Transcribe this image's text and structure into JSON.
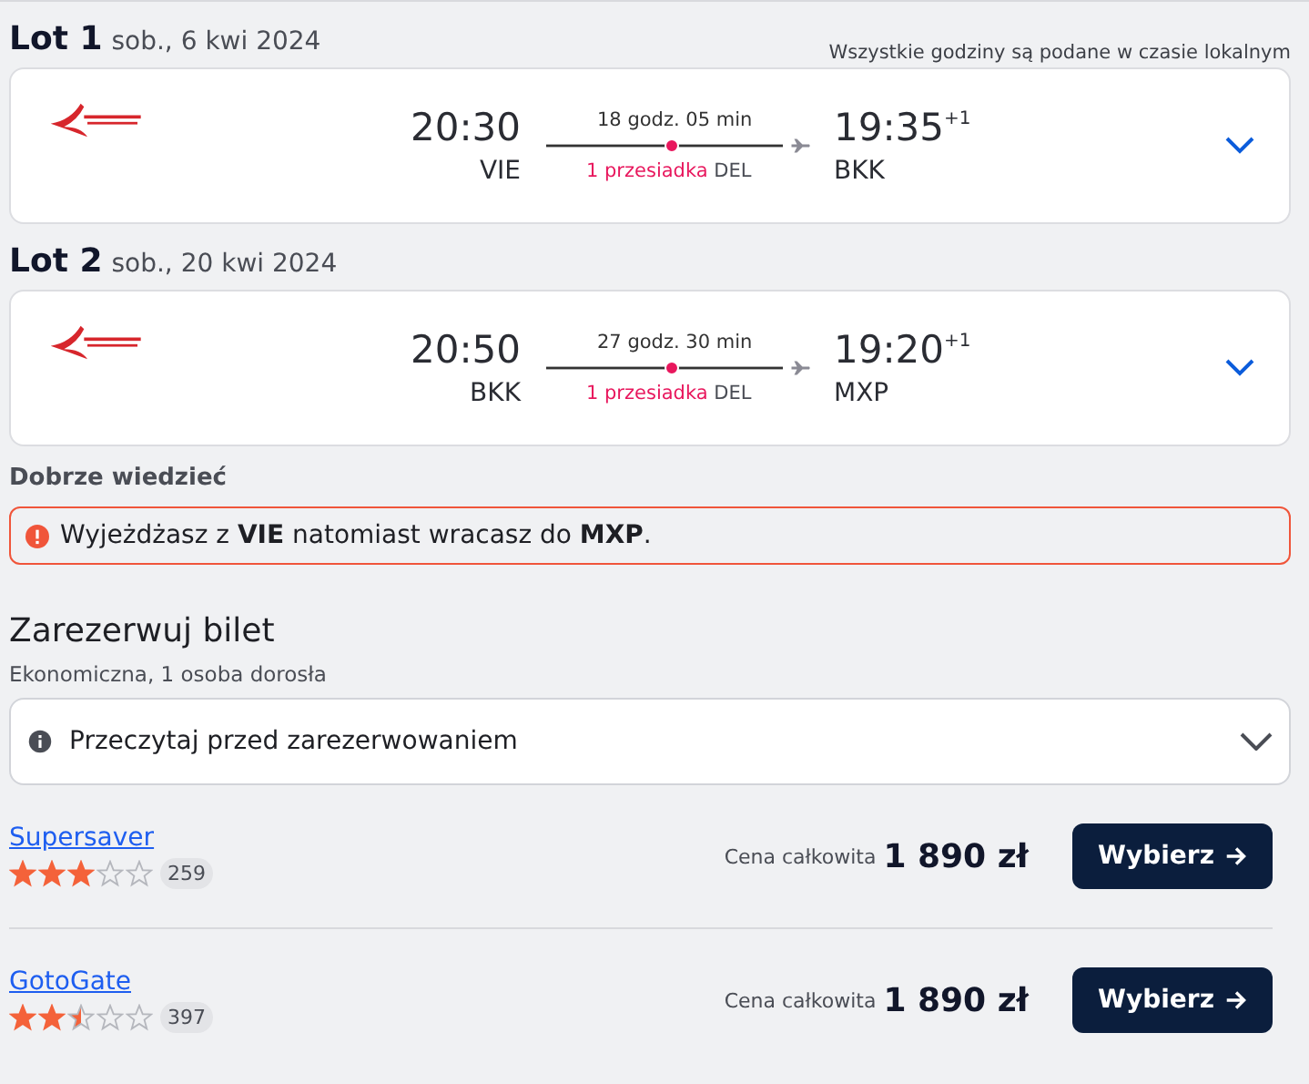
{
  "timezone_note": "Wszystkie godziny są podane w czasie lokalnym",
  "flights": [
    {
      "label": "Lot 1",
      "date": "sob., 6 kwi 2024",
      "depart_time": "20:30",
      "depart_code": "VIE",
      "duration": "18 godz. 05 min",
      "stops": "1 przesiadka",
      "via": "DEL",
      "arrive_time": "19:35",
      "day_offset": "+1",
      "arrive_code": "BKK",
      "expanded": false
    },
    {
      "label": "Lot 2",
      "date": "sob., 20 kwi 2024",
      "depart_time": "20:50",
      "depart_code": "BKK",
      "duration": "27 godz. 30 min",
      "stops": "1 przesiadka",
      "via": "DEL",
      "arrive_time": "19:20",
      "day_offset": "+1",
      "arrive_code": "MXP",
      "expanded": false
    }
  ],
  "good_to_know": {
    "title": "Dobrze wiedzieć",
    "alert": "Wyjeżdżasz z **VIE** natomiast wracasz do **MXP**."
  },
  "booking": {
    "title": "Zarezerwuj bilet",
    "subtitle": "Ekonomiczna, 1 osoba dorosła",
    "notice": {
      "label": "Przeczytaj przed zarezerwowaniem",
      "expanded": false
    },
    "providers": [
      {
        "name": "Supersaver",
        "stars": 3,
        "reviews": "259",
        "price_label": "Cena całkowita",
        "price": "1 890 zł",
        "button": "Wybierz"
      },
      {
        "name": "GotoGate",
        "stars": 2.5,
        "reviews": "397",
        "price_label": "Cena całkowita",
        "price": "1 890 zł",
        "button": "Wybierz"
      }
    ]
  }
}
